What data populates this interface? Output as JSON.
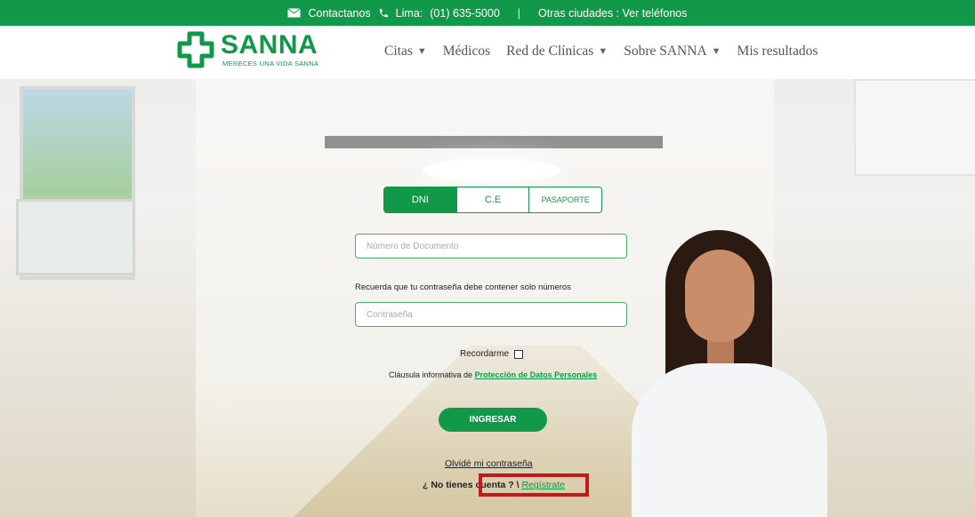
{
  "topbar": {
    "contact_label": "Contactanos",
    "lima_label": "Lima:",
    "lima_phone": "(01) 635-5000",
    "separator": "|",
    "other_cities": "Otras ciudades : Ver teléfonos"
  },
  "logo": {
    "name": "SANNA",
    "tagline": "MERECES UNA VIDA SANNA"
  },
  "nav": {
    "items": [
      {
        "label": "Citas",
        "caret": "▼"
      },
      {
        "label": "Médicos",
        "caret": ""
      },
      {
        "label": "Red de Clínicas",
        "caret": "▼"
      },
      {
        "label": "Sobre SANNA",
        "caret": "▼"
      },
      {
        "label": "Mis resultados",
        "caret": ""
      }
    ]
  },
  "login": {
    "tabs": [
      "DNI",
      "C.E",
      "PASAPORTE"
    ],
    "active_tab": "DNI",
    "document_placeholder": "Número de Documento",
    "hint": "Recuerda que tu contraseña debe contener solo números",
    "password_placeholder": "Contraseña",
    "remember_label": "Recordarme",
    "clausula_prefix": "Cláusula informativa de",
    "clausula_link": "Protección de Datos Personales",
    "submit_label": "INGRESAR",
    "forgot_label": "Olvidé mi contraseña",
    "register_prefix": "¿ No tienes cuenta ? \\",
    "register_link": "Regístrate"
  },
  "colors": {
    "brand": "#119848",
    "highlight": "#c01a1a"
  }
}
